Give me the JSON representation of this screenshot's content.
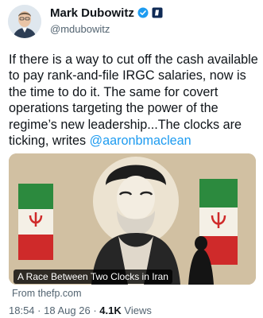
{
  "author": {
    "display_name": "Mark Dubowitz",
    "handle": "@mdubowitz",
    "verified_color": "#1d9bf0"
  },
  "tweet": {
    "text_before_mention": "If there is a way to cut off the cash available to pay rank-and-file IRGC salaries, now is the time to do it. The same for covert operations targeting the power of the regime’s new leadership...The clocks are ticking, writes ",
    "mention": "@aaronbmaclean",
    "mention_color": "#1d9bf0"
  },
  "card": {
    "caption": "A Race Between Two Clocks in Iran",
    "source": "From thefp.com"
  },
  "meta": {
    "time": "18:54",
    "date": "18 Aug 26",
    "separator": "·",
    "views_count": "4.1K",
    "views_label": "Views"
  }
}
